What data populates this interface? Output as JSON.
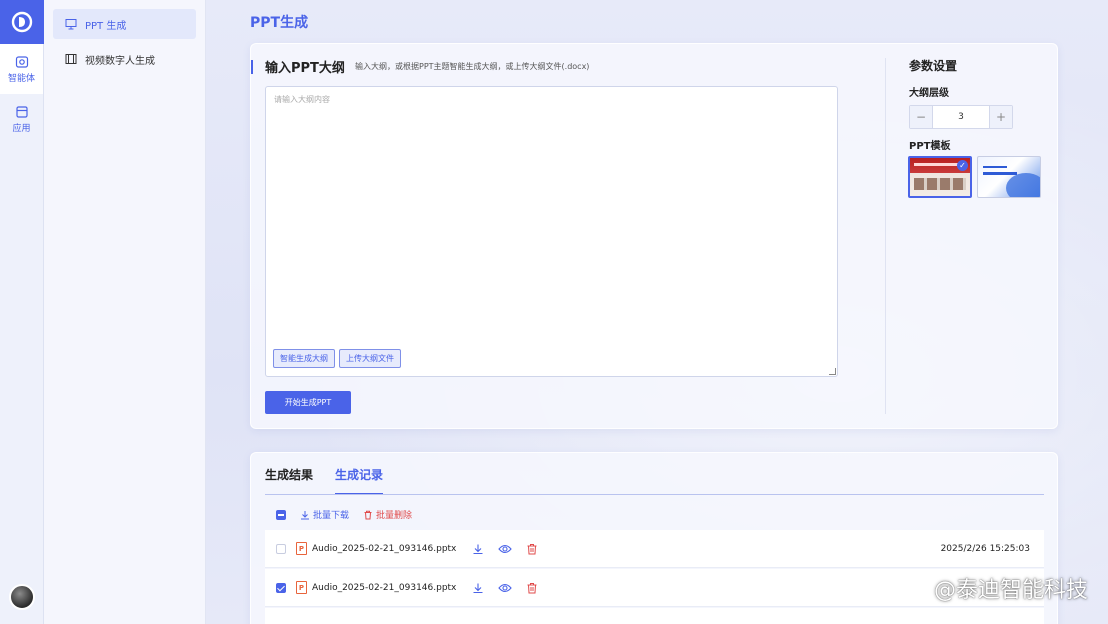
{
  "rail": {
    "items": [
      {
        "label": "智能体",
        "icon": "robot-icon"
      },
      {
        "label": "应用",
        "icon": "app-icon"
      }
    ]
  },
  "sidebar": {
    "items": [
      {
        "label": "PPT 生成",
        "icon": "presentation-icon",
        "active": true
      },
      {
        "label": "视频数字人生成",
        "icon": "film-icon",
        "active": false
      }
    ]
  },
  "page": {
    "title": "PPT生成"
  },
  "outline": {
    "title": "输入PPT大纲",
    "hint": "输入大纲，或根据PPT主题智能生成大纲，或上传大纲文件(.docx)",
    "placeholder": "请输入大纲内容",
    "smart_button": "智能生成大纲",
    "upload_button": "上传大纲文件",
    "start_button": "开始生成PPT"
  },
  "params": {
    "title": "参数设置",
    "level_label": "大纲层级",
    "level_value": "3",
    "minus": "−",
    "plus": "+",
    "template_label": "PPT模板",
    "selected_template": 1
  },
  "results": {
    "tabs": [
      "生成结果",
      "生成记录"
    ],
    "active_tab": 1,
    "batch_download": "批量下载",
    "batch_delete": "批量删除",
    "rows": [
      {
        "name": "Audio_2025-02-21_093146.pptx",
        "date": "2025/2/26 15:25:03",
        "checked": false
      },
      {
        "name": "Audio_2025-02-21_093146.pptx",
        "date": "",
        "checked": true
      }
    ]
  },
  "watermark": "@泰迪智能科技",
  "colors": {
    "accent": "#4a63e8",
    "danger": "#e04b4b"
  }
}
